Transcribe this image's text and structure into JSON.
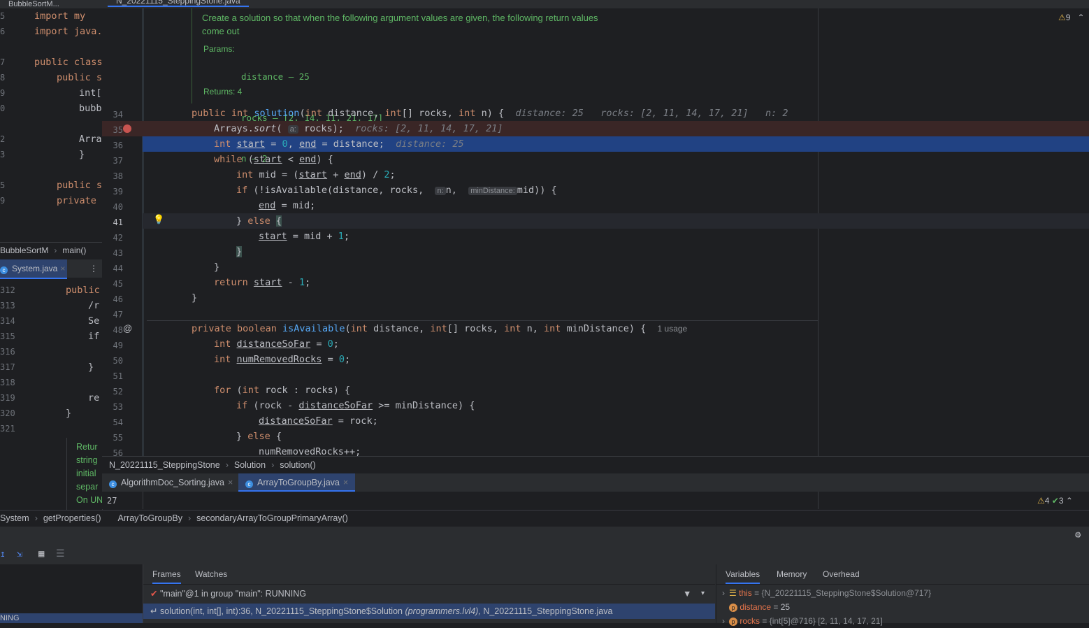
{
  "left": {
    "top_tab": "BubbleSortM...",
    "code_lines": [
      {
        "n": "5",
        "text": "import my"
      },
      {
        "n": "6",
        "text": "import java."
      },
      {
        "n": "7",
        "text": "public class"
      },
      {
        "n": "8",
        "text": "public s"
      },
      {
        "n": "9",
        "text": "int["
      },
      {
        "n": "0",
        "text": "bubb"
      },
      {
        "n": "2",
        "text": "Arra"
      },
      {
        "n": "3",
        "text": "}"
      },
      {
        "n": "5",
        "text": "public s"
      },
      {
        "n": "9",
        "text": "private"
      }
    ],
    "breadcrumb": [
      "BubbleSortM",
      "main()"
    ],
    "system_tab": "System.java",
    "system_lines": [
      {
        "n": "312",
        "text": "public"
      },
      {
        "n": "313",
        "text": "/r"
      },
      {
        "n": "314",
        "text": "Se"
      },
      {
        "n": "315",
        "text": "if"
      },
      {
        "n": "316",
        "text": ""
      },
      {
        "n": "317",
        "text": "}"
      },
      {
        "n": "318",
        "text": ""
      },
      {
        "n": "319",
        "text": "re"
      },
      {
        "n": "320",
        "text": "}"
      },
      {
        "n": "321",
        "text": ""
      }
    ],
    "doc_lines": [
      "Retur",
      "string",
      "initial",
      "separ",
      "On UN"
    ]
  },
  "editor": {
    "file_tab": "N_20221115_SteppingStone.java",
    "doc": {
      "description": "Create a solution so that when the following argument values are given, the following return values come out",
      "params_label": "Params:",
      "params": [
        "distance – 25",
        "rocks – [2, 14, 11, 21, 17]",
        "n – 2"
      ],
      "returns": "Returns: 4"
    },
    "warnings": "9",
    "gutter": [
      "34",
      "35",
      "36",
      "37",
      "38",
      "39",
      "40",
      "41",
      "42",
      "43",
      "44",
      "45",
      "46",
      "47",
      "48",
      "49",
      "50",
      "51",
      "52",
      "53",
      "54",
      "55",
      "56"
    ],
    "inline": {
      "l34_distance": "distance: 25",
      "l34_rocks": "rocks: [2, 11, 14, 17, 21]",
      "l34_n": "n: 2",
      "l35_rocks": "rocks: [2, 11, 14, 17, 21]",
      "l36_distance": "distance: 25",
      "l35_hint": "a:",
      "l39_hint_n": "n:",
      "l39_hint_min": "minDistance:",
      "usages": "1 usage"
    },
    "breadcrumb": [
      "N_20221115_SteppingStone",
      "Solution",
      "solution()"
    ]
  },
  "bottom_editor": {
    "tabs": [
      "AlgorithmDoc_Sorting.java",
      "ArrayToGroupBy.java"
    ],
    "line": "27",
    "warnings": "4",
    "checks": "3",
    "breadcrumb": [
      "System",
      "getProperties()",
      "ArrayToGroupBy",
      "secondaryArrayToGroupPrimaryArray()"
    ]
  },
  "debug": {
    "frames_tabs": [
      "Frames",
      "Watches"
    ],
    "thread": "\"main\"@1 in group \"main\": RUNNING",
    "frame": "solution(int, int[], int):36, N_20221115_SteppingStone$Solution",
    "frame_pkg": "(programmers.lvl4),",
    "frame_file": "N_20221115_SteppingStone.java",
    "var_tabs": [
      "Variables",
      "Memory",
      "Overhead"
    ],
    "vars": [
      {
        "name": "this",
        "value": "{N_20221115_SteppingStone$Solution@717}"
      },
      {
        "name": "distance",
        "value": "25"
      },
      {
        "name": "rocks",
        "value": "{int[5]@716} [2, 11, 14, 17, 21]"
      }
    ],
    "left_status": "NING"
  }
}
